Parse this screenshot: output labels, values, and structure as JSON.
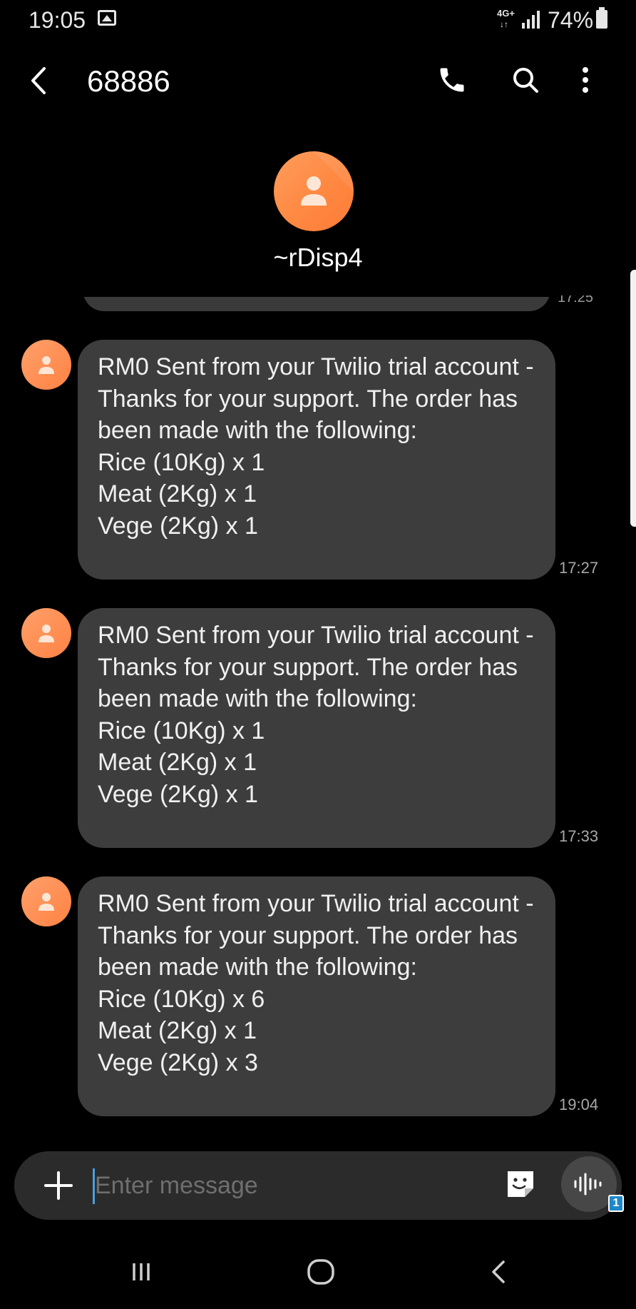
{
  "status_bar": {
    "time": "19:05",
    "network_type": "4G+",
    "network_arrows": "↓↑",
    "battery_percent": "74%",
    "icons": [
      "image-icon",
      "signal-icon",
      "battery-icon"
    ]
  },
  "header": {
    "title": "68886",
    "actions": [
      "phone-icon",
      "search-icon",
      "more-vertical-icon"
    ]
  },
  "contact": {
    "name": "~rDisp4",
    "avatar_color": "#ff8a44"
  },
  "messages": [
    {
      "text": "RM0 Sent from your Twilio trial account - Thanks for your support. The order has been made with the following:\nRice (10Kg) x 1\nMeat (2Kg) x 1\nVege (2Kg) x 1",
      "time": "17:27"
    },
    {
      "text": "RM0 Sent from your Twilio trial account - Thanks for your support. The order has been made with the following:\nRice (10Kg) x 1\nMeat (2Kg) x 1\nVege (2Kg) x 1",
      "time": "17:33"
    },
    {
      "text": "RM0 Sent from your Twilio trial account - Thanks for your support. The order has been made with the following:\nRice (10Kg) x 6\nMeat (2Kg) x 1\nVege (2Kg) x 3",
      "time": "19:04"
    }
  ],
  "previous_message_time": "17:25",
  "compose": {
    "placeholder": "Enter message",
    "sim_badge": "1"
  },
  "colors": {
    "background": "#000000",
    "bubble": "#3d3d3d",
    "accent_cursor": "#4a9fe0",
    "avatar": "#ff8a44",
    "sim_badge": "#1e88c8"
  }
}
